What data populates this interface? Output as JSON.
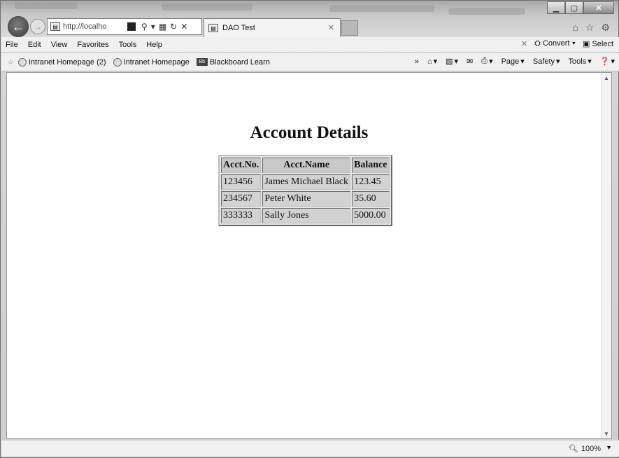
{
  "browser": {
    "address_url": "http://localho",
    "tab_title": "DAO Test"
  },
  "menu": {
    "items": [
      "File",
      "Edit",
      "View",
      "Favorites",
      "Tools",
      "Help"
    ],
    "convert_label": "Convert",
    "select_label": "Select"
  },
  "favorites": {
    "items": [
      "Intranet Homepage (2)",
      "Intranet Homepage",
      "Blackboard Learn"
    ]
  },
  "commands": {
    "page": "Page",
    "safety": "Safety",
    "tools": "Tools"
  },
  "content": {
    "title": "Account Details",
    "table": {
      "headers": [
        "Acct.No.",
        "Acct.Name",
        "Balance"
      ],
      "rows": [
        [
          "123456",
          "James Michael Black",
          "123.45"
        ],
        [
          "234567",
          "Peter White",
          "35.60"
        ],
        [
          "333333",
          "Sally Jones",
          "5000.00"
        ]
      ]
    }
  },
  "status": {
    "zoom": "100%"
  }
}
